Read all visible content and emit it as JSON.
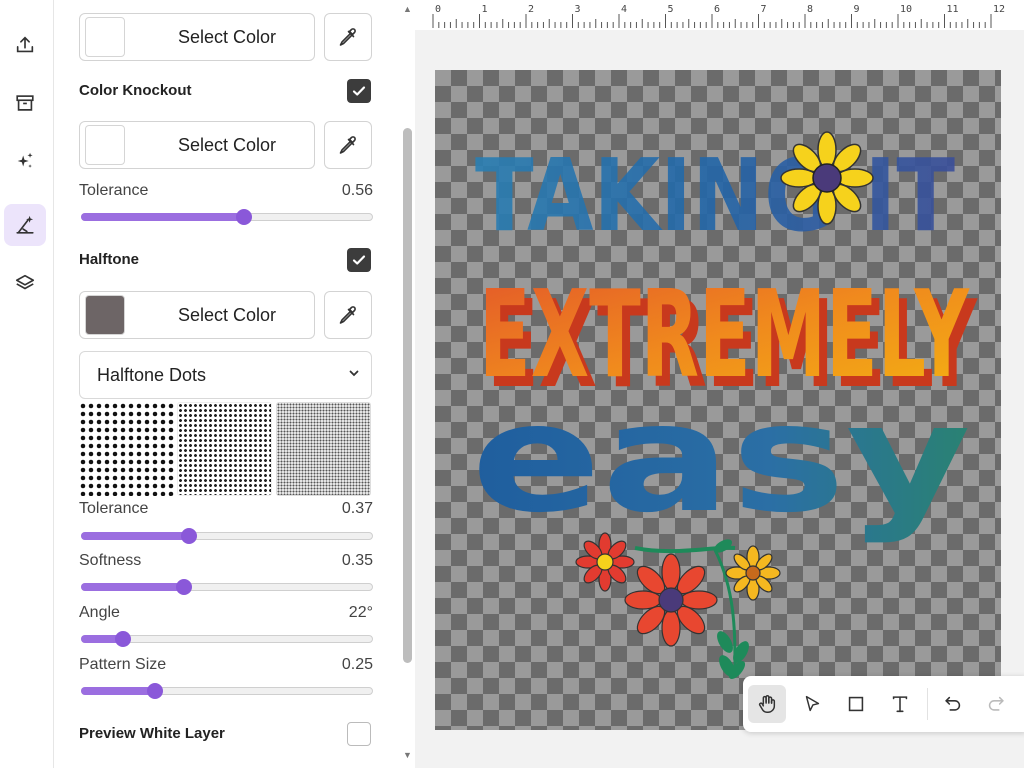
{
  "rail": {
    "items": [
      {
        "icon": "upload-icon",
        "active": false
      },
      {
        "icon": "archive-icon",
        "active": false
      },
      {
        "icon": "sparkles-icon",
        "active": false
      },
      {
        "icon": "magic-wand-icon",
        "active": true
      },
      {
        "icon": "layers-icon",
        "active": false
      }
    ]
  },
  "panel": {
    "top_color": {
      "label": "Select Color",
      "swatch": "#ffffff"
    },
    "color_knockout": {
      "title": "Color Knockout",
      "checked": true,
      "color_label": "Select Color",
      "swatch": "#ffffff",
      "tolerance_label": "Tolerance",
      "tolerance_value": "0.56",
      "tolerance": 0.56
    },
    "halftone": {
      "title": "Halftone",
      "checked": true,
      "color_label": "Select Color",
      "swatch": "#6d6566",
      "style_value": "Halftone Dots",
      "sliders": [
        {
          "label": "Tolerance",
          "value": "0.37",
          "fraction": 0.37
        },
        {
          "label": "Softness",
          "value": "0.35",
          "fraction": 0.35
        },
        {
          "label": "Angle",
          "value": "22°",
          "fraction": 0.14
        },
        {
          "label": "Pattern Size",
          "value": "0.25",
          "fraction": 0.25
        }
      ]
    },
    "preview_white_layer": {
      "label": "Preview White Layer",
      "checked": false
    }
  },
  "ruler": {
    "marks": [
      "0",
      "1",
      "2",
      "3",
      "4",
      "5",
      "6",
      "7",
      "8",
      "9",
      "10",
      "11",
      "12"
    ]
  },
  "artwork": {
    "line1": "TAKING IT",
    "line2": "EXTREMELY",
    "line3": "easy"
  },
  "toolbar": {
    "tools": [
      "hand-icon",
      "pointer-icon",
      "rectangle-icon",
      "text-icon",
      "undo-icon",
      "redo-icon"
    ]
  },
  "colors": {
    "accent": "#8a58d9",
    "accent_light": "#ece4fb"
  }
}
